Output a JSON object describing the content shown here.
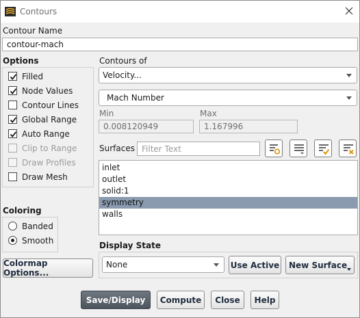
{
  "window": {
    "title": "Contours"
  },
  "contour_name": {
    "label": "Contour Name",
    "value": "contour-mach"
  },
  "options": {
    "label": "Options",
    "items": [
      {
        "label": "Filled",
        "checked": true,
        "enabled": true
      },
      {
        "label": "Node Values",
        "checked": true,
        "enabled": true
      },
      {
        "label": "Contour Lines",
        "checked": false,
        "enabled": true
      },
      {
        "label": "Global Range",
        "checked": true,
        "enabled": true
      },
      {
        "label": "Auto Range",
        "checked": true,
        "enabled": true
      },
      {
        "label": "Clip to Range",
        "checked": false,
        "enabled": false
      },
      {
        "label": "Draw Profiles",
        "checked": false,
        "enabled": false
      },
      {
        "label": "Draw Mesh",
        "checked": false,
        "enabled": true
      }
    ]
  },
  "coloring": {
    "label": "Coloring",
    "options": [
      {
        "label": "Banded",
        "selected": false
      },
      {
        "label": "Smooth",
        "selected": true
      }
    ]
  },
  "colormap_button": "Colormap Options...",
  "contours_of": {
    "label": "Contours of",
    "category": "Velocity...",
    "quantity": "Mach Number"
  },
  "range": {
    "min_label": "Min",
    "min_value": "0.008120949",
    "max_label": "Max",
    "max_value": "1.167996"
  },
  "surfaces": {
    "label": "Surfaces",
    "filter_placeholder": "Filter Text",
    "items": [
      "inlet",
      "outlet",
      "solid:1",
      "symmetry",
      "walls"
    ],
    "selected": "symmetry",
    "tool_icons": [
      "filter-surfaces-icon",
      "select-list-icon",
      "select-all-icon",
      "deselect-all-icon"
    ]
  },
  "display_state": {
    "label": "Display State",
    "value": "None",
    "use_active": "Use Active",
    "new_surface": "New Surface"
  },
  "footer": {
    "save_display": "Save/Display",
    "compute": "Compute",
    "close": "Close",
    "help": "Help"
  }
}
